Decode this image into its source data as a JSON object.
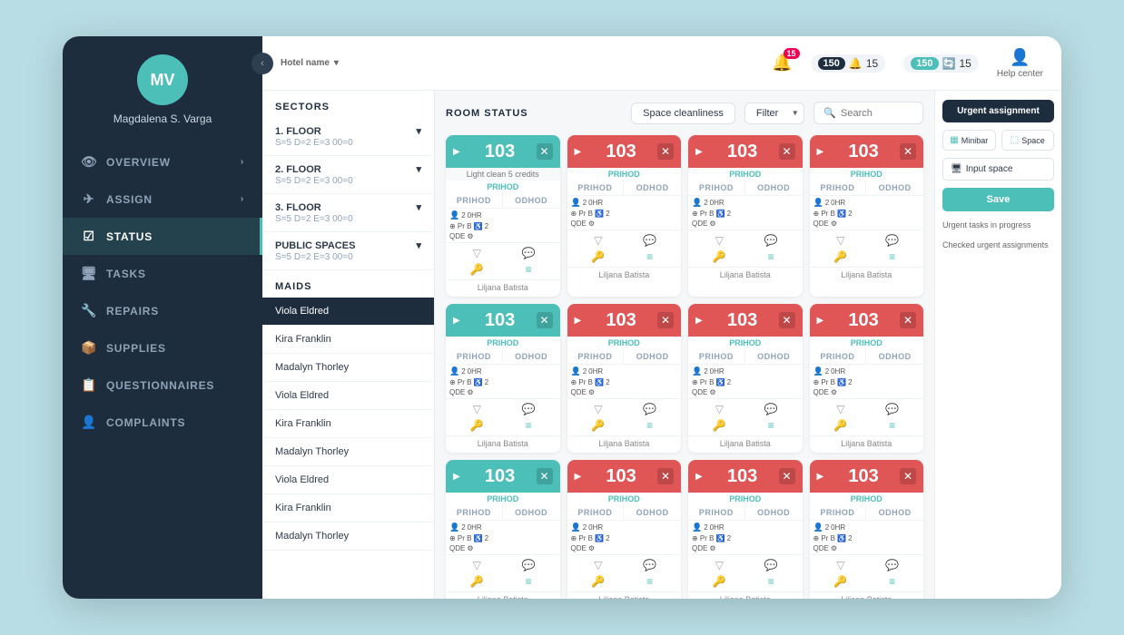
{
  "sidebar": {
    "user_initials": "MV",
    "user_name": "Magdalena S. Varga",
    "nav_items": [
      {
        "label": "OVERVIEW",
        "icon": "👁",
        "arrow": "›",
        "active": false
      },
      {
        "label": "ASSIGN",
        "icon": "✈",
        "arrow": "›",
        "active": false
      },
      {
        "label": "STATUS",
        "icon": "☑",
        "arrow": "",
        "active": true
      },
      {
        "label": "TASKS",
        "icon": "🖥",
        "arrow": "",
        "active": false
      },
      {
        "label": "REPAIRS",
        "icon": "🔧",
        "arrow": "",
        "active": false
      },
      {
        "label": "SUPPLIES",
        "icon": "📦",
        "arrow": "",
        "active": false
      },
      {
        "label": "QUESTIONNAIRES",
        "icon": "📋",
        "arrow": "",
        "active": false
      },
      {
        "label": "COMPLAINTS",
        "icon": "👤",
        "arrow": "",
        "active": false
      }
    ]
  },
  "header": {
    "hotel_name": "Hotel name",
    "notification_count": "15",
    "badge1_num": "150",
    "badge1_count": "15",
    "badge2_num": "150",
    "badge2_count": "15",
    "help_label": "Help center"
  },
  "left_panel": {
    "sectors_title": "SECTORS",
    "sectors": [
      {
        "name": "1. FLOOR",
        "sub": "S=5 D=2 E=3 00=0",
        "expanded": true
      },
      {
        "name": "2. FLOOR",
        "sub": "S=5 D=2 E=3 00=0",
        "expanded": false
      },
      {
        "name": "3. FLOOR",
        "sub": "S=5 D=2 E=3 00=0",
        "expanded": false
      },
      {
        "name": "PUBLIC SPACES",
        "sub": "S=5 D=2 E=3 00=0",
        "expanded": false
      }
    ],
    "maids_title": "MAIDS",
    "maids": [
      {
        "name": "Viola Eldred",
        "active": true
      },
      {
        "name": "Kira Franklin",
        "active": false
      },
      {
        "name": "Madalyn Thorley",
        "active": false
      },
      {
        "name": "Viola Eldred",
        "active": false
      },
      {
        "name": "Kira Franklin",
        "active": false
      },
      {
        "name": "Madalyn Thorley",
        "active": false
      },
      {
        "name": "Viola Eldred",
        "active": false
      },
      {
        "name": "Kira Franklin",
        "active": false
      },
      {
        "name": "Madalyn Thorley",
        "active": false
      }
    ]
  },
  "center": {
    "room_status_label": "ROOM STATUS",
    "space_cleanliness_btn": "Space cleanliness",
    "filter_btn": "Filter",
    "search_placeholder": "Search",
    "rooms": [
      {
        "number": "103",
        "color": "teal",
        "subtitle": "Light clean 5 credits",
        "badge": "PRIHOD",
        "col1": "PRIHOD",
        "col2": "ODHOD",
        "footer": "Liljana Batista"
      },
      {
        "number": "103",
        "color": "red",
        "subtitle": "",
        "badge": "PRIHOD",
        "col1": "PRIHOD",
        "col2": "ODHOD",
        "footer": "Liljana Batista"
      },
      {
        "number": "103",
        "color": "red",
        "subtitle": "",
        "badge": "PRIHOD",
        "col1": "PRIHOD",
        "col2": "ODHOD",
        "footer": "Liljana Batista"
      },
      {
        "number": "103",
        "color": "red",
        "subtitle": "",
        "badge": "PRIHOD",
        "col1": "PRIHOD",
        "col2": "ODHOD",
        "footer": "Liljana Batista"
      },
      {
        "number": "103",
        "color": "teal",
        "subtitle": "",
        "badge": "PRIHOD",
        "col1": "PRIHOD",
        "col2": "ODHOD",
        "footer": "Liljana Batista"
      },
      {
        "number": "103",
        "color": "red",
        "subtitle": "",
        "badge": "PRIHOD",
        "col1": "PRIHOD",
        "col2": "ODHOD",
        "footer": "Liljana Batista"
      },
      {
        "number": "103",
        "color": "red",
        "subtitle": "",
        "badge": "PRIHOD",
        "col1": "PRIHOD",
        "col2": "ODHOD",
        "footer": "Liljana Batista"
      },
      {
        "number": "103",
        "color": "red",
        "subtitle": "",
        "badge": "PRIHOD",
        "col1": "PRIHOD",
        "col2": "ODHOD",
        "footer": "Liljana Batista"
      },
      {
        "number": "103",
        "color": "teal",
        "subtitle": "",
        "badge": "PRIHOD",
        "col1": "PRIHOD",
        "col2": "ODHOD",
        "footer": "Liljana Batista"
      },
      {
        "number": "103",
        "color": "red",
        "subtitle": "",
        "badge": "PRIHOD",
        "col1": "PRIHOD",
        "col2": "ODHOD",
        "footer": "Liljana Batista"
      },
      {
        "number": "103",
        "color": "red",
        "subtitle": "",
        "badge": "PRIHOD",
        "col1": "PRIHOD",
        "col2": "ODHOD",
        "footer": "Liljana Batista"
      },
      {
        "number": "103",
        "color": "red",
        "subtitle": "",
        "badge": "PRIHOD",
        "col1": "PRIHOD",
        "col2": "ODHOD",
        "footer": "Liljana Batista"
      }
    ]
  },
  "right_panel": {
    "urgent_title": "Urgent assignment",
    "minibar_btn": "Minibar",
    "space_btn": "Space",
    "input_space_label": "Input space",
    "save_btn": "Save",
    "urgent_tasks_label": "Urgent tasks in progress",
    "checked_urgent_label": "Checked urgent assignments"
  },
  "colors": {
    "sidebar_bg": "#1e2d3d",
    "teal": "#4bbfb8",
    "red": "#e05555",
    "active_nav": "#4bbfb8"
  }
}
